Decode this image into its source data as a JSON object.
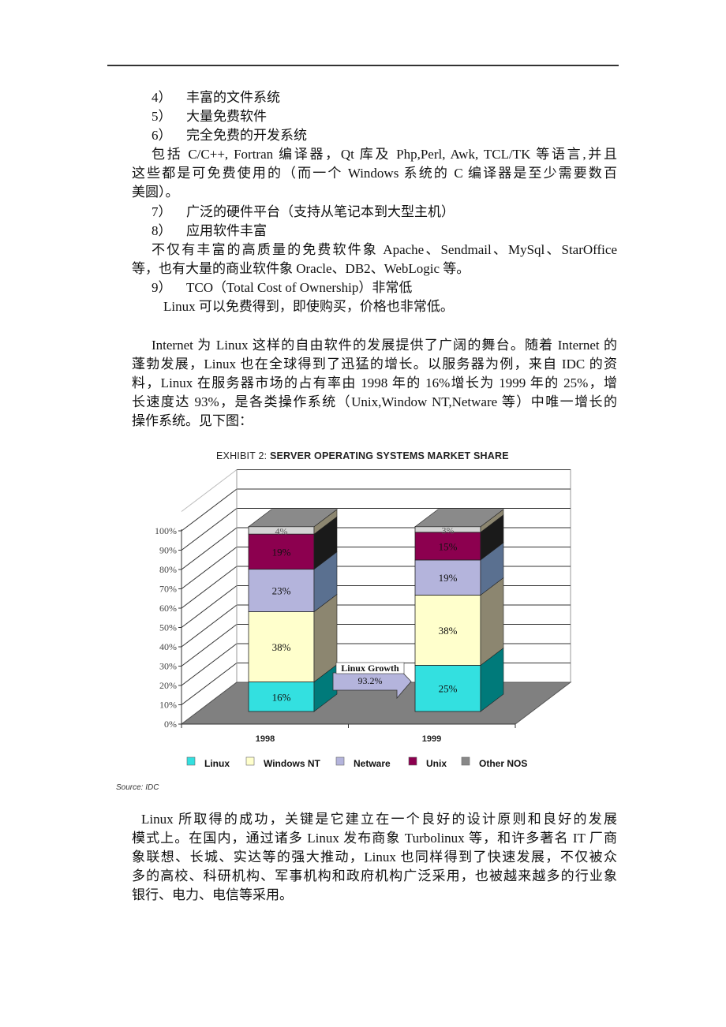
{
  "list_top": [
    {
      "num": "4）",
      "text": "丰富的文件系统"
    },
    {
      "num": "5）",
      "text": "大量免费软件"
    },
    {
      "num": "6）",
      "text": "完全免费的开发系统"
    }
  ],
  "para_dev": [
    "包括 C/C++, Fortran 编译器，Qt 库及 Php,Perl, Awk, TCL/TK 等语言,并且",
    "这些都是可免费使用的（而一个 Windows 系统的 C 编译器是至少需要数百",
    "美圆）。"
  ],
  "list_mid": [
    {
      "num": "7）",
      "text": "广泛的硬件平台（支持从笔记本到大型主机）"
    },
    {
      "num": "8）",
      "text": "应用软件丰富"
    }
  ],
  "para_apps": [
    "不仅有丰富的高质量的免费软件象 Apache、Sendmail、MySql、StarOffice",
    "等，也有大量的商业软件象 Oracle、DB2、WebLogic 等。"
  ],
  "list_tco": {
    "num": "9）",
    "text": "TCO（Total Cost of Ownership）非常低"
  },
  "para_tco": "Linux 可以免费得到，即使购买，价格也非常低。",
  "para_internet": [
    "Internet 为 Linux 这样的自由软件的发展提供了广阔的舞台。随着 Internet 的",
    "蓬勃发展，Linux 也在全球得到了迅猛的增长。以服务器为例，来自 IDC 的资",
    "料，Linux 在服务器市场的占有率由 1998 年的 16%增长为 1999 年的 25%，增",
    "长速度达 93%，是各类操作系统（Unix,Window NT,Netware 等）中唯一增长的",
    "操作系统。见下图："
  ],
  "chart_title_prefix": "EXHIBIT 2: ",
  "chart_title_main": "SERVER OPERATING SYSTEMS MARKET SHARE",
  "chart_source": "Source: IDC",
  "chart_data": {
    "type": "bar",
    "stacked": true,
    "three_d": true,
    "title": "EXHIBIT 2: SERVER OPERATING SYSTEMS MARKET SHARE",
    "categories": [
      "1998",
      "1999"
    ],
    "series": [
      {
        "name": "Linux",
        "values": [
          16,
          25
        ],
        "color": "#33e0e0",
        "side": "#007a7a"
      },
      {
        "name": "Windows NT",
        "values": [
          38,
          38
        ],
        "color": "#ffffcc",
        "side": "#8c8670"
      },
      {
        "name": "Netware",
        "values": [
          23,
          19
        ],
        "color": "#b4b4dc",
        "side": "#5a7090"
      },
      {
        "name": "Unix",
        "values": [
          19,
          15
        ],
        "color": "#8c004f",
        "side": "#1a1a1a"
      },
      {
        "name": "Other NOS",
        "values": [
          4,
          3
        ],
        "color": "#d4d4d4",
        "side": "#8c8670"
      }
    ],
    "data_labels": [
      [
        "16%",
        "38%",
        "23%",
        "19%",
        "4%"
      ],
      [
        "25%",
        "38%",
        "19%",
        "15%",
        "3%"
      ]
    ],
    "y_ticks": [
      "0%",
      "10%",
      "20%",
      "30%",
      "40%",
      "50%",
      "60%",
      "70%",
      "80%",
      "90%",
      "100%"
    ],
    "ylim": [
      0,
      100
    ],
    "xlabel": "",
    "ylabel": "",
    "grid": true,
    "legend_position": "bottom",
    "annotation": {
      "label": "Linux Growth",
      "value": "93.2%"
    },
    "source": "Source: IDC"
  },
  "para_success": [
    "Linux 所取得的成功，关键是它建立在一个良好的设计原则和良好的发展",
    "模式上。在国内，通过诸多 Linux 发布商象 Turbolinux 等，和许多著名 IT 厂商",
    "象联想、长城、实达等的强大推动，Linux 也同样得到了快速发展，不仅被众",
    "多的高校、科研机构、军事机构和政府机构广泛采用，也被越来越多的行业象",
    "银行、电力、电信等采用。"
  ]
}
